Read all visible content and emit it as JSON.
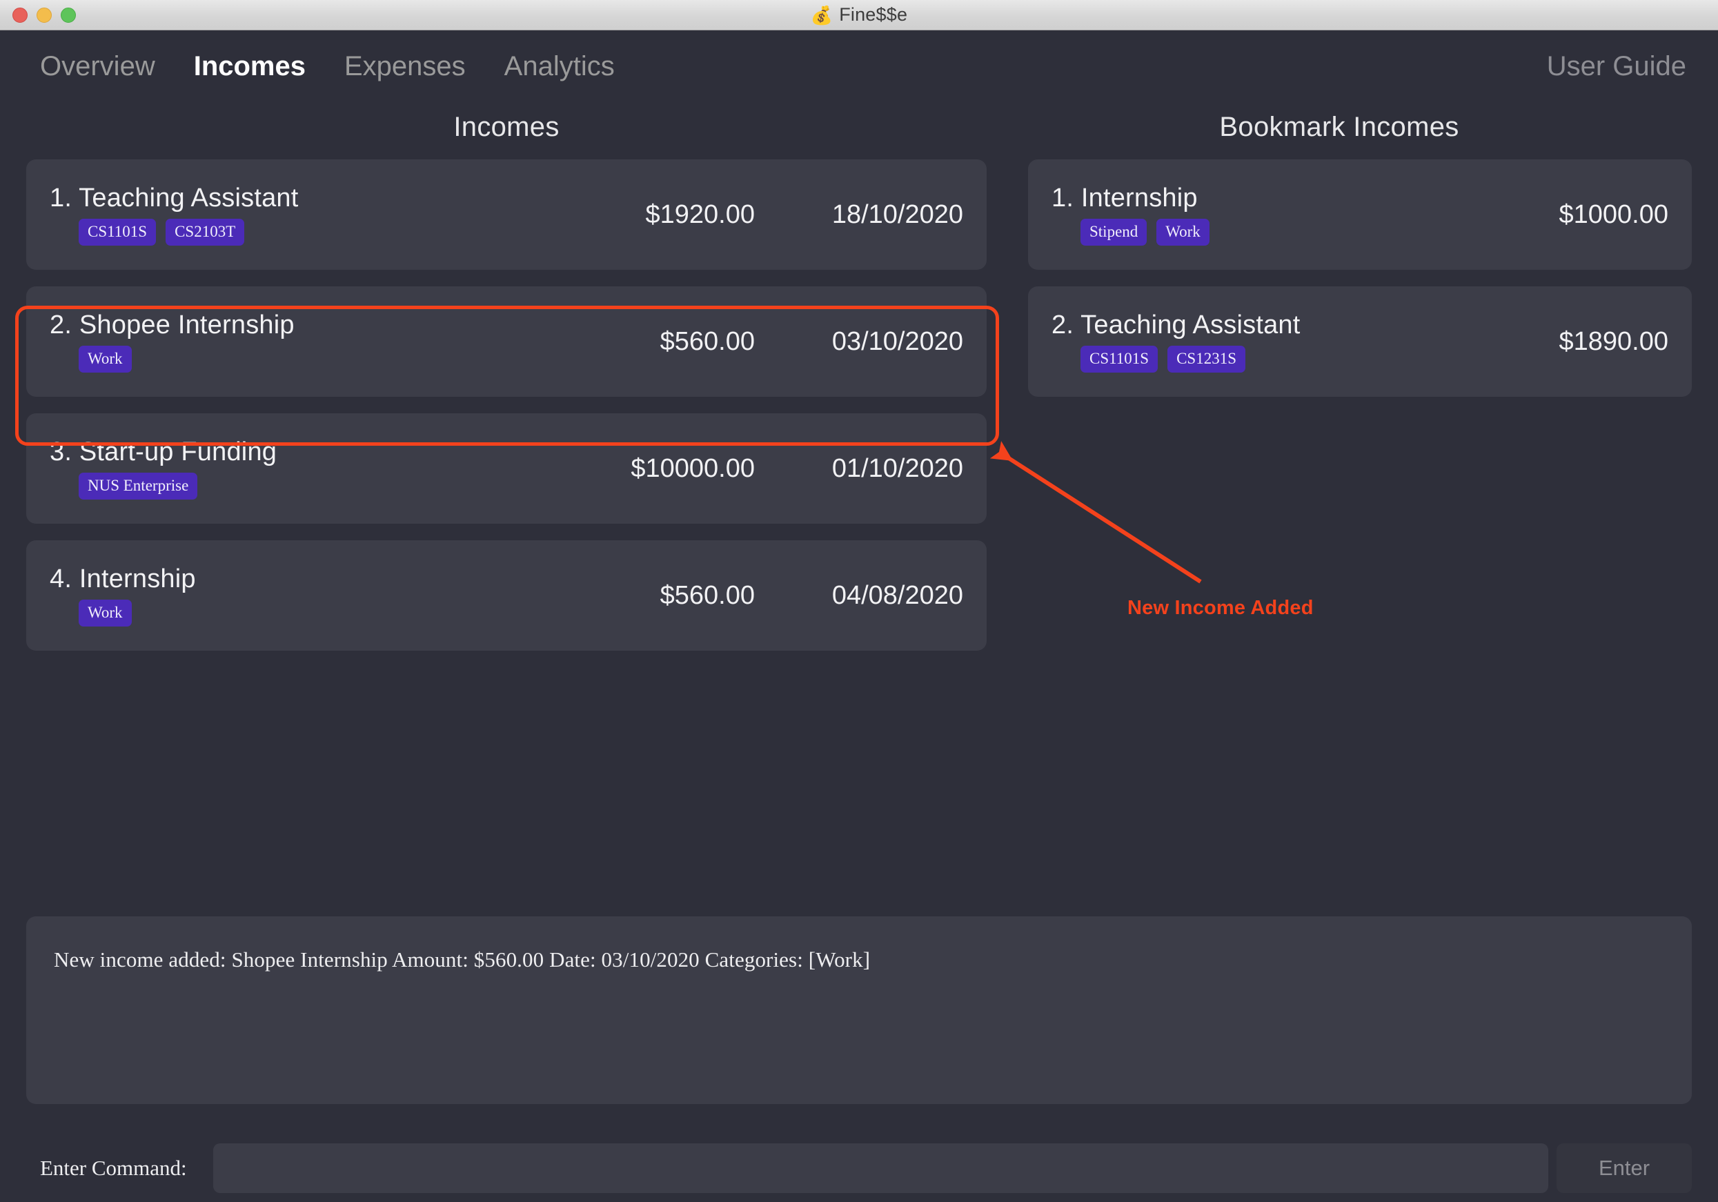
{
  "window": {
    "title": "Fine$$e",
    "title_icon": "money-bag-emoji",
    "traffic_lights": [
      "close",
      "minimize",
      "zoom"
    ]
  },
  "nav": {
    "tabs": [
      {
        "label": "Overview",
        "active": false
      },
      {
        "label": "Incomes",
        "active": true
      },
      {
        "label": "Expenses",
        "active": false
      },
      {
        "label": "Analytics",
        "active": false
      }
    ],
    "user_guide_label": "User Guide"
  },
  "incomes_panel": {
    "title": "Incomes",
    "items": [
      {
        "index": "1.",
        "name": "Teaching Assistant",
        "tags": [
          "CS1101S",
          "CS2103T"
        ],
        "amount": "$1920.00",
        "date": "18/10/2020",
        "highlighted": false
      },
      {
        "index": "2.",
        "name": "Shopee Internship",
        "tags": [
          "Work"
        ],
        "amount": "$560.00",
        "date": "03/10/2020",
        "highlighted": true
      },
      {
        "index": "3.",
        "name": "Start-up Funding",
        "tags": [
          "NUS Enterprise"
        ],
        "amount": "$10000.00",
        "date": "01/10/2020",
        "highlighted": false
      },
      {
        "index": "4.",
        "name": "Internship",
        "tags": [
          "Work"
        ],
        "amount": "$560.00",
        "date": "04/08/2020",
        "highlighted": false
      }
    ]
  },
  "bookmark_panel": {
    "title": "Bookmark Incomes",
    "items": [
      {
        "index": "1.",
        "name": "Internship",
        "tags": [
          "Stipend",
          "Work"
        ],
        "amount": "$1000.00"
      },
      {
        "index": "2.",
        "name": "Teaching Assistant",
        "tags": [
          "CS1101S",
          "CS1231S"
        ],
        "amount": "$1890.00"
      }
    ]
  },
  "annotation": {
    "label": "New Income Added",
    "color": "#f4421c"
  },
  "result": {
    "text": "New income added: Shopee Internship Amount: $560.00 Date: 03/10/2020 Categories: [Work]"
  },
  "command_bar": {
    "label": "Enter Command:",
    "input_value": "",
    "input_placeholder": "",
    "enter_label": "Enter"
  },
  "colors": {
    "page_background": "#2e2f3a",
    "card_background": "#3c3d48",
    "tag_background": "#4b2bb8",
    "accent_annotation": "#f4421c",
    "text_primary": "#f2f2f4",
    "text_muted": "#8e8e94"
  }
}
